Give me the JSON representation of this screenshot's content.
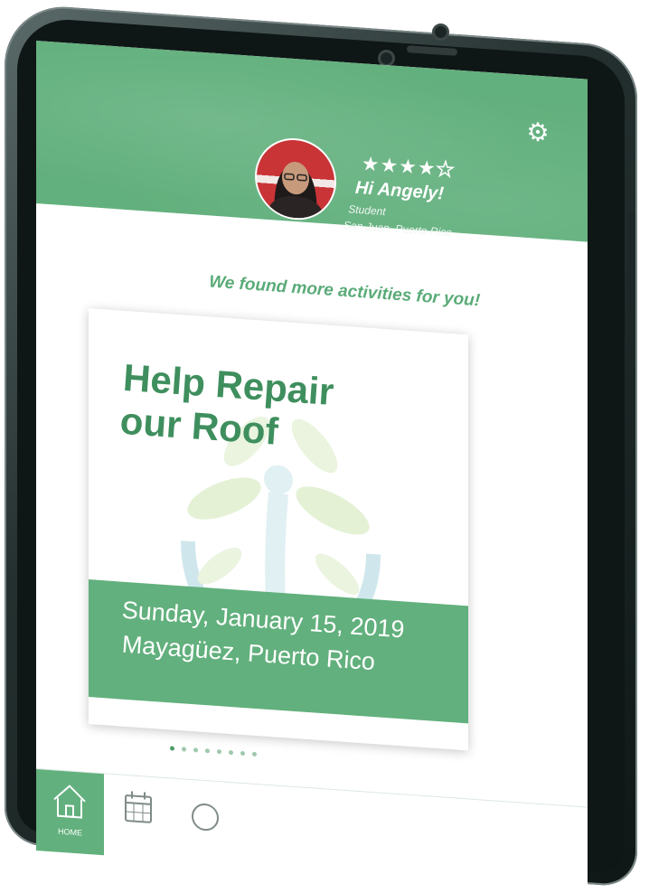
{
  "header": {
    "rating": {
      "filled": 4,
      "total": 5
    },
    "greeting": "Hi Angely!",
    "role": "Student",
    "location": "San Juan, Puerto Rico"
  },
  "tagline": "We found more activities for you!",
  "card": {
    "title_line1": "Help Repair",
    "title_line2": "our Roof",
    "date": "Sunday, January 15, 2019",
    "place": "Mayagüez, Puerto Rico"
  },
  "pager": {
    "count": 8,
    "active_index": 0
  },
  "tabs": [
    {
      "name": "home",
      "icon": "home-icon",
      "label": "HOME",
      "active": true
    },
    {
      "name": "calendar",
      "icon": "calendar-icon",
      "active": false
    },
    {
      "name": "search",
      "icon": "search-icon",
      "active": false
    }
  ],
  "colors": {
    "brand_green": "#62b07d",
    "brand_dark_green": "#3f8f5e",
    "phone_frame": "#1a2424"
  }
}
